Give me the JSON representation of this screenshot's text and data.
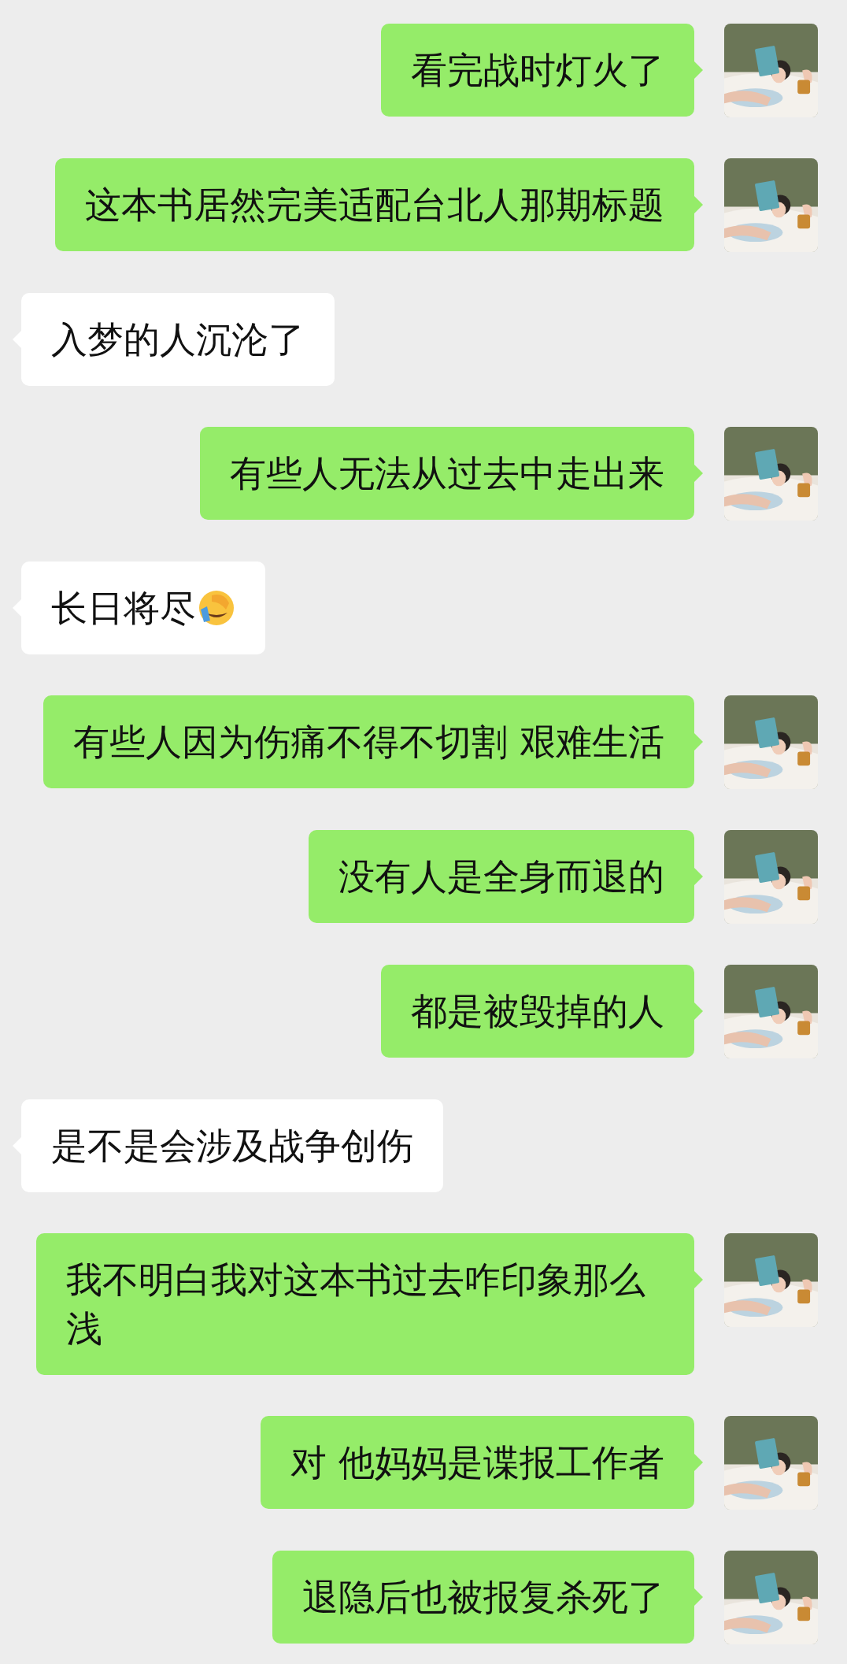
{
  "messages": [
    {
      "kind": "sent",
      "text": "看完战时灯火了"
    },
    {
      "kind": "sent",
      "text": "这本书居然完美适配台北人那期标题"
    },
    {
      "kind": "received",
      "text": "入梦的人沉沦了"
    },
    {
      "kind": "sent",
      "text": "有些人无法从过去中走出来"
    },
    {
      "kind": "emoji",
      "text": "长日将尽"
    },
    {
      "kind": "sent",
      "text": "有些人因为伤痛不得不切割 艰难生活"
    },
    {
      "kind": "sent",
      "text": "没有人是全身而退的"
    },
    {
      "kind": "sent",
      "text": "都是被毁掉的人"
    },
    {
      "kind": "received",
      "text": "是不是会涉及战争创伤"
    },
    {
      "kind": "sent",
      "text": "我不明白我对这本书过去咋印象那么浅"
    },
    {
      "kind": "sent",
      "text": "对 他妈妈是谍报工作者"
    },
    {
      "kind": "sent",
      "text": "退隐后也被报复杀死了"
    }
  ]
}
